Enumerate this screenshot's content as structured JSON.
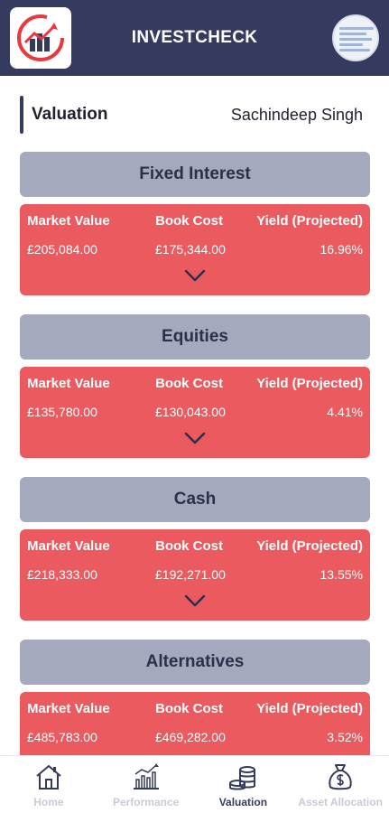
{
  "app": {
    "title": "INVESTCHECK"
  },
  "page": {
    "title": "Valuation",
    "user_name": "Sachindeep Singh"
  },
  "columns": {
    "market_value": "Market Value",
    "book_cost": "Book Cost",
    "yield": "Yield (Projected)"
  },
  "sections": [
    {
      "name": "Fixed Interest",
      "market_value": "£205,084.00",
      "book_cost": "£175,344.00",
      "yield": "16.96%"
    },
    {
      "name": "Equities",
      "market_value": "£135,780.00",
      "book_cost": "£130,043.00",
      "yield": "4.41%"
    },
    {
      "name": "Cash",
      "market_value": "£218,333.00",
      "book_cost": "£192,271.00",
      "yield": "13.55%"
    },
    {
      "name": "Alternatives",
      "market_value": "£485,783.00",
      "book_cost": "£469,282.00",
      "yield": "3.52%"
    }
  ],
  "nav": [
    {
      "label": "Home",
      "icon": "home-icon",
      "active": false
    },
    {
      "label": "Performance",
      "icon": "chart-icon",
      "active": false
    },
    {
      "label": "Valuation",
      "icon": "coins-icon",
      "active": true
    },
    {
      "label": "Asset Allocation",
      "icon": "money-bag-icon",
      "active": false
    }
  ],
  "colors": {
    "header": "#353b5e",
    "section_header": "#a5a9bd",
    "card": "#ea5a5f",
    "nav_inactive": "#c9cbd3"
  }
}
